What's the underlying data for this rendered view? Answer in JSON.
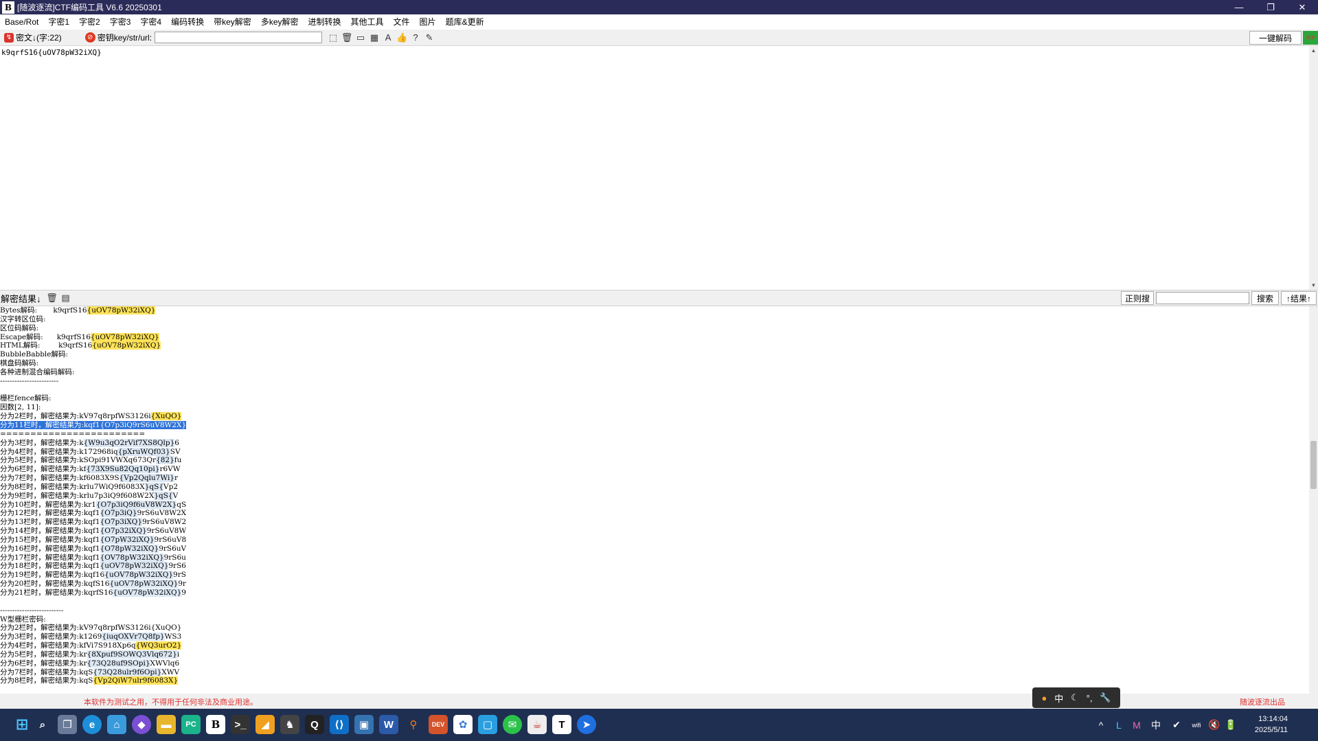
{
  "window": {
    "title": "[随波逐流]CTF编码工具 V6.6 20250301",
    "app_icon": "B",
    "controls": [
      "—",
      "❐",
      "✕"
    ]
  },
  "menu": [
    "Base/Rot",
    "字密1",
    "字密2",
    "字密3",
    "字密4",
    "编码转换",
    "带key解密",
    "多key解密",
    "进制转换",
    "其他工具",
    "文件",
    "图片",
    "题库&更新"
  ],
  "toolbar": {
    "cipher_label": "密文↓(字:22)",
    "key_label": "密钥key/str/url:",
    "key_value": "",
    "one_click_button": "一键解码",
    "flag_icon": "≡>"
  },
  "cipher_text": "k9qrfS16{uOV78pW32iXQ}",
  "result_bar": {
    "label": "解密结果↓",
    "regex_button": "正则搜",
    "search_value": "",
    "search_button": "搜索",
    "result_up_button": "↑结果↑"
  },
  "output_lines": [
    [
      {
        "t": "Bytes解码:       k9qrfS16"
      },
      {
        "t": "{uOV78pW32iXQ}",
        "c": "hl"
      }
    ],
    [
      {
        "t": "汉字转区位码:"
      }
    ],
    [
      {
        "t": "区位码解码:"
      }
    ],
    [
      {
        "t": "Escape解码:      k9qrfS16"
      },
      {
        "t": "{uOV78pW32iXQ}",
        "c": "hl"
      }
    ],
    [
      {
        "t": "HTML解码:        k9qrfS16"
      },
      {
        "t": "{uOV78pW32iXQ}",
        "c": "hl"
      }
    ],
    [
      {
        "t": "BubbleBabble解码:"
      }
    ],
    [
      {
        "t": "棋盘码解码:"
      }
    ],
    [
      {
        "t": "各种进制混合编码解码:"
      }
    ],
    [
      {
        "t": "------------------------"
      }
    ],
    [
      {
        "t": ""
      }
    ],
    [
      {
        "t": "栅栏fence解码:"
      }
    ],
    [
      {
        "t": "因数[2, 11]:"
      }
    ],
    [
      {
        "t": "分为2栏时，解密结果为:kV97q8rpfWS3126i"
      },
      {
        "t": "{XuQO}",
        "c": "hl"
      }
    ],
    [
      {
        "t": "分为11栏时，解密结果为:kqf1",
        "c": "sel"
      },
      {
        "t": "{O7p3iQ9rS6uV8W2X}",
        "c": "sel"
      }
    ],
    [
      {
        "t": "========================"
      }
    ],
    [
      {
        "t": "分为3栏时，解密结果为:k"
      },
      {
        "t": "{W9u3qO2rVif7XS8Qlp}",
        "c": "hlb"
      },
      {
        "t": "6"
      }
    ],
    [
      {
        "t": "分为4栏时，解密结果为:k172968iq"
      },
      {
        "t": "{pXruWQf03}",
        "c": "hlb"
      },
      {
        "t": "SV"
      }
    ],
    [
      {
        "t": "分为5栏时，解密结果为:kSOpi91VWXq673Qr"
      },
      {
        "t": "{82}",
        "c": "hlb"
      },
      {
        "t": "fu"
      }
    ],
    [
      {
        "t": "分为6栏时，解密结果为:kf"
      },
      {
        "t": "{73X9Su82Qq10pi}",
        "c": "hlb"
      },
      {
        "t": "r6VW"
      }
    ],
    [
      {
        "t": "分为7栏时，解密结果为:kf6083X9S"
      },
      {
        "t": "{Vp2Qqlu7Wi}",
        "c": "hlb"
      },
      {
        "t": "r"
      }
    ],
    [
      {
        "t": "分为8栏时，解密结果为:krlu7WiQ9f6083X"
      },
      {
        "t": "}qS{",
        "c": "hlb"
      },
      {
        "t": "Vp2"
      }
    ],
    [
      {
        "t": "分为9栏时，解密结果为:krlu7p3iQ9f608W2X"
      },
      {
        "t": "}qS{",
        "c": "hlb"
      },
      {
        "t": "V"
      }
    ],
    [
      {
        "t": "分为10栏时，解密结果为:kr1"
      },
      {
        "t": "{O7p3iQ9f6uV8W2X}",
        "c": "hlb"
      },
      {
        "t": "qS"
      }
    ],
    [
      {
        "t": "分为12栏时，解密结果为:kqf1"
      },
      {
        "t": "{O7p3iQ}",
        "c": "hlb"
      },
      {
        "t": "9rS6uV8W2X"
      }
    ],
    [
      {
        "t": "分为13栏时，解密结果为:kqf1"
      },
      {
        "t": "{O7p3iXQ}",
        "c": "hlb"
      },
      {
        "t": "9rS6uV8W2"
      }
    ],
    [
      {
        "t": "分为14栏时，解密结果为:kqf1"
      },
      {
        "t": "{O7p32iXQ}",
        "c": "hlb"
      },
      {
        "t": "9rS6uV8W"
      }
    ],
    [
      {
        "t": "分为15栏时，解密结果为:kqf1"
      },
      {
        "t": "{O7pW32iXQ}",
        "c": "hlb"
      },
      {
        "t": "9rS6uV8"
      }
    ],
    [
      {
        "t": "分为16栏时，解密结果为:kqf1"
      },
      {
        "t": "{O78pW32iXQ}",
        "c": "hlb"
      },
      {
        "t": "9rS6uV"
      }
    ],
    [
      {
        "t": "分为17栏时，解密结果为:kqf1"
      },
      {
        "t": "{OV78pW32iXQ}",
        "c": "hlb"
      },
      {
        "t": "9rS6u"
      }
    ],
    [
      {
        "t": "分为18栏时，解密结果为:kqf1"
      },
      {
        "t": "{uOV78pW32iXQ}",
        "c": "hlb"
      },
      {
        "t": "9rS6"
      }
    ],
    [
      {
        "t": "分为19栏时，解密结果为:kqf16"
      },
      {
        "t": "{uOV78pW32iXQ}",
        "c": "hlb"
      },
      {
        "t": "9rS"
      }
    ],
    [
      {
        "t": "分为20栏时，解密结果为:kqfS16"
      },
      {
        "t": "{uOV78pW32iXQ}",
        "c": "hlb"
      },
      {
        "t": "9r"
      }
    ],
    [
      {
        "t": "分为21栏时，解密结果为:kqrfS16"
      },
      {
        "t": "{uOV78pW32iXQ}",
        "c": "hlb"
      },
      {
        "t": "9"
      }
    ],
    [
      {
        "t": ""
      }
    ],
    [
      {
        "t": "--------------------------"
      }
    ],
    [
      {
        "t": "W型栅栏密码:"
      }
    ],
    [
      {
        "t": "分为2栏时，解密结果为:kV97q8rpfWS3126i{XuQO}"
      }
    ],
    [
      {
        "t": "分为3栏时，解密结果为:k1269"
      },
      {
        "t": "{iuqOXVr7Q8fp}",
        "c": "hlb"
      },
      {
        "t": "WS3"
      }
    ],
    [
      {
        "t": "分为4栏时，解密结果为:kfVi7S918Xp6q"
      },
      {
        "t": "{WQ3urO2}",
        "c": "hl"
      }
    ],
    [
      {
        "t": "分为5栏时，解密结果为:kr"
      },
      {
        "t": "{8Xpuf9SOWQ3Vlq672}",
        "c": "hlb"
      },
      {
        "t": "i"
      }
    ],
    [
      {
        "t": "分为6栏时，解密结果为:kr"
      },
      {
        "t": "{73Q28uf9SOpi}",
        "c": "hlb"
      },
      {
        "t": "XWVlq6"
      }
    ],
    [
      {
        "t": "分为7栏时，解密结果为:kqS"
      },
      {
        "t": "{73Q28ulr9f6Opi}",
        "c": "hlb"
      },
      {
        "t": "XWV"
      }
    ],
    [
      {
        "t": "分为8栏时，解密结果为:kqS"
      },
      {
        "t": "{Vp2QiW7ulr9f6083X}",
        "c": "hl"
      }
    ]
  ],
  "status": {
    "notice": "本软件为测试之用，不得用于任何非法及商业用途。",
    "brand": "随波逐流出品"
  },
  "ime": [
    "●",
    "中",
    "☾",
    "°,",
    "🔧"
  ],
  "taskbar": {
    "apps": [
      "start-icon",
      "search-icon",
      "task-view-icon",
      "edge-icon",
      "store-icon",
      "app-purple-icon",
      "file-explorer-icon",
      "pycharm-icon",
      "ctf-tool-icon",
      "terminal-icon",
      "app-orange-icon",
      "app-figure-icon",
      "qq-icon",
      "vscode-icon",
      "remote-desktop-icon",
      "word-icon",
      "search-tool-icon",
      "game-dev-icon",
      "app-cloud-icon",
      "app-square-icon",
      "wechat-icon",
      "java-icon",
      "typora-icon",
      "feishu-icon"
    ],
    "tray": [
      "^",
      "L",
      "M",
      "中",
      "✔",
      "wifi",
      "🔇",
      "🔋"
    ],
    "time": "13:14:04",
    "date": "2025/5/11"
  }
}
